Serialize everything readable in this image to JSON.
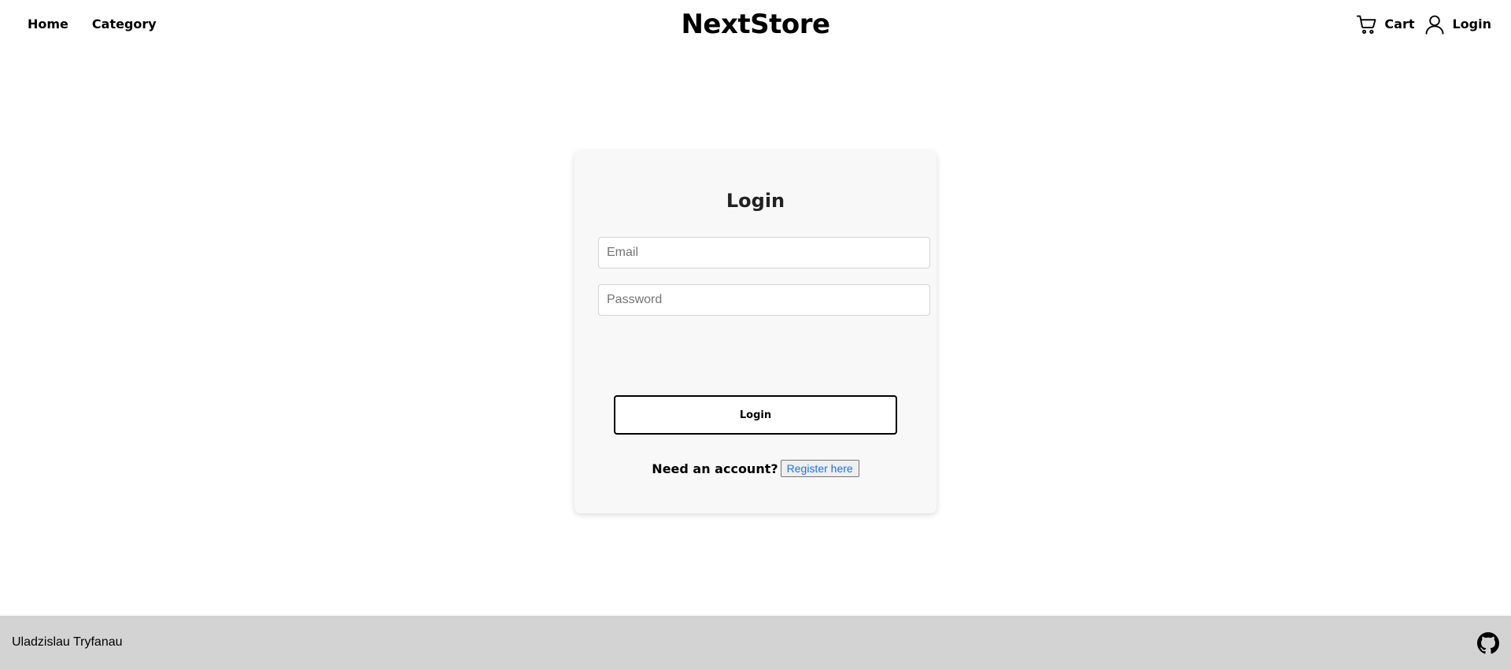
{
  "header": {
    "nav": [
      {
        "label": "Home"
      },
      {
        "label": "Category"
      }
    ],
    "brand": "NextStore",
    "cart": {
      "label": "Cart",
      "icon": "cart-icon"
    },
    "account": {
      "label": "Login",
      "icon": "user-icon"
    }
  },
  "login_card": {
    "title": "Login",
    "email": {
      "placeholder": "Email",
      "value": ""
    },
    "password": {
      "placeholder": "Password",
      "value": ""
    },
    "submit_label": "Login",
    "register_prompt": "Need an account?",
    "register_link": "Register here"
  },
  "footer": {
    "author": "Uladzislau Tryfanau",
    "github_icon": "github-icon"
  },
  "colors": {
    "card_background": "#f8f8f8",
    "footer_background": "#d3d3d3",
    "link": "#1a73e8"
  }
}
